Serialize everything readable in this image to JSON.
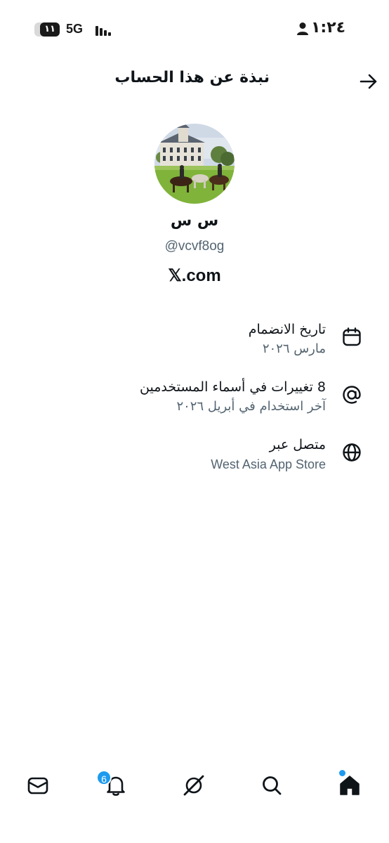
{
  "status_bar": {
    "battery_level": "١١",
    "network": "5G",
    "time": "١:٢٤"
  },
  "header": {
    "title": "نبذة عن هذا الحساب"
  },
  "profile": {
    "display_name": "س س",
    "username": "@vcvf8og",
    "website": "𝕏.com"
  },
  "info": {
    "joined": {
      "title": "تاريخ الانضمام",
      "value": "مارس ٢٠٢٦",
      "icon": "calendar-icon"
    },
    "username_changes": {
      "title": "8 تغييرات في أسماء المستخدمين",
      "value": "آخر استخدام في أبريل ٢٠٢٦",
      "icon": "at-sign-icon"
    },
    "connected_via": {
      "title": "متصل عبر",
      "value": "West Asia App Store",
      "icon": "globe-icon"
    }
  },
  "bottom_nav": {
    "notifications_badge": "6",
    "items": [
      "messages-icon",
      "notifications-bell-icon",
      "grok-icon",
      "search-icon",
      "home-icon"
    ]
  },
  "colors": {
    "accent": "#1d9bf0",
    "text_primary": "#0f1419",
    "text_secondary": "#536471"
  }
}
